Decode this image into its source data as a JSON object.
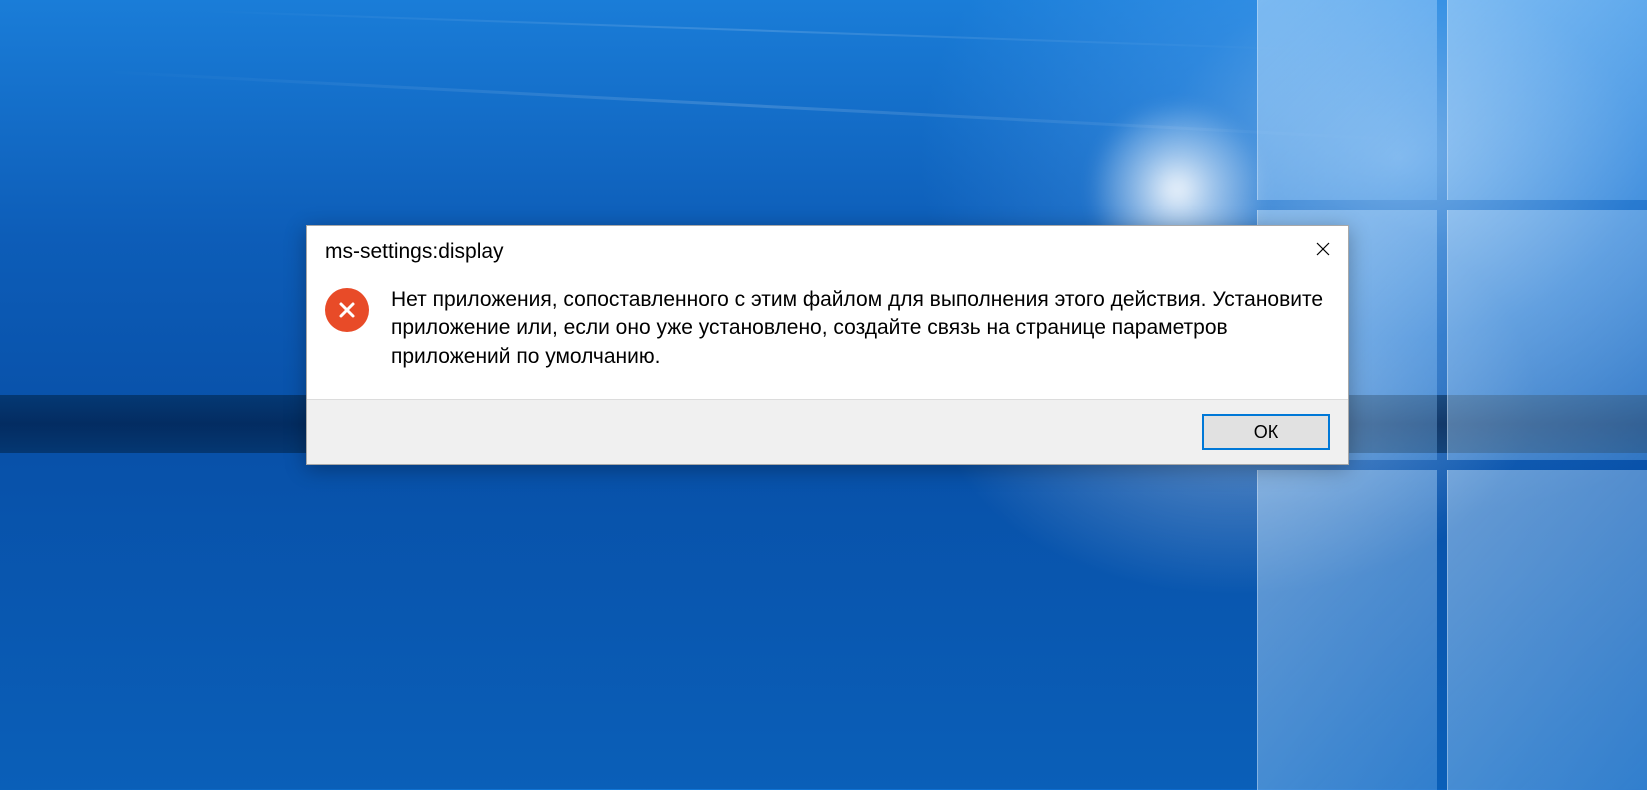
{
  "dialog": {
    "title": "ms-settings:display",
    "message": "Нет приложения, сопоставленного с этим файлом для выполнения этого действия. Установите приложение или, если оно уже установлено, создайте связь на странице параметров приложений по умолчанию.",
    "ok_label": "ОК",
    "icon": "error-icon",
    "close_icon": "close-icon"
  }
}
